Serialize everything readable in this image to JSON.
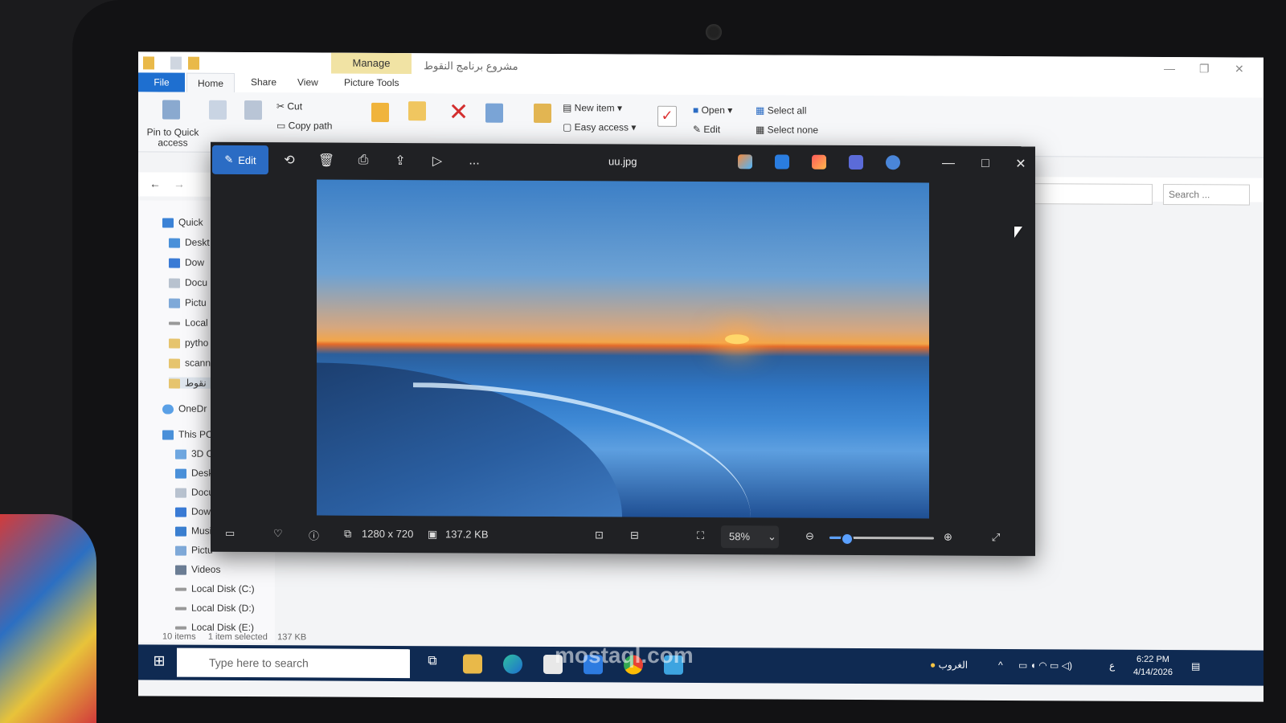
{
  "explorer": {
    "folder_title": "مشروع برنامج النقوط",
    "manage_tab": "Manage",
    "picture_tools": "Picture Tools",
    "tabs": {
      "file": "File",
      "home": "Home",
      "share": "Share",
      "view": "View"
    },
    "ribbon": {
      "pin": "Pin to Quick access",
      "cut": "Cut",
      "copy_path": "Copy path",
      "new_item": "New item",
      "easy_access": "Easy access",
      "open": "Open",
      "edit": "Edit",
      "select_all": "Select all",
      "select_none": "Select none"
    },
    "search_placeholder": "Search ...",
    "nav": [
      "Quick",
      "Deskt",
      "Dow",
      "Docu",
      "Pictu",
      "Local",
      "pytho",
      "scann",
      "نقوط",
      "OneDr",
      "This PC",
      "3D O",
      "Deskt",
      "Docu",
      "Dow",
      "Musi",
      "Pictu",
      "Videos",
      "Local Disk (C:)",
      "Local Disk (D:)",
      "Local Disk (E:)"
    ],
    "status": {
      "items": "10 items",
      "selected": "1 item selected",
      "size": "137 KB"
    }
  },
  "viewer": {
    "edit_label": "Edit",
    "more": "...",
    "title": "uu.jpg",
    "min": "—",
    "max": "□",
    "close": "✕",
    "dimensions": "1280 x 720",
    "file_size": "137.2 KB",
    "zoom": "58%",
    "zoom_fraction": 0.15
  },
  "taskbar": {
    "search_placeholder": "Type here to search",
    "weather": "الغروب",
    "lang": "ع",
    "time": "6:22 PM",
    "date": "4/14/2026"
  },
  "watermark": "mostaql.com"
}
